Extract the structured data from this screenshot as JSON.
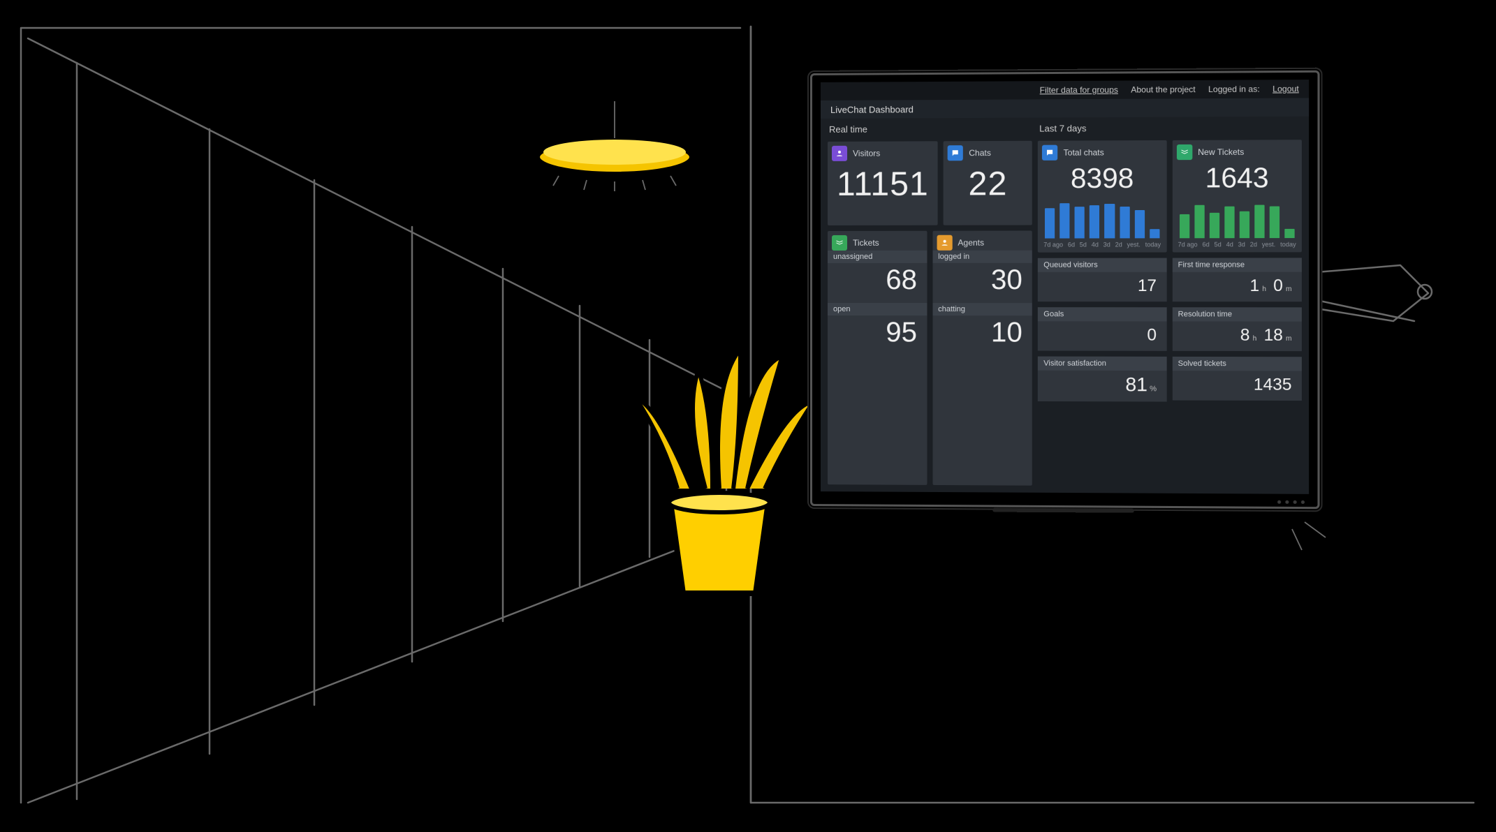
{
  "topbar": {
    "filter": "Filter data for groups",
    "about": "About the project",
    "logged_in_prefix": "Logged in as:",
    "logout": "Logout"
  },
  "title": "LiveChat Dashboard",
  "sections": {
    "realtime": "Real time",
    "last7": "Last 7 days"
  },
  "realtime": {
    "visitors": {
      "label": "Visitors",
      "value": "11151"
    },
    "chats": {
      "label": "Chats",
      "value": "22"
    },
    "tickets": {
      "label": "Tickets",
      "unassigned_label": "unassigned",
      "unassigned": "68",
      "open_label": "open",
      "open": "95"
    },
    "agents": {
      "label": "Agents",
      "logged_in_label": "logged in",
      "logged_in": "30",
      "chatting_label": "chatting",
      "chatting": "10"
    }
  },
  "last7": {
    "total_chats": {
      "label": "Total chats",
      "value": "8398"
    },
    "new_tickets": {
      "label": "New Tickets",
      "value": "1643"
    },
    "queued": {
      "label": "Queued visitors",
      "value": "17"
    },
    "goals": {
      "label": "Goals",
      "value": "0"
    },
    "satisfaction": {
      "label": "Visitor satisfaction",
      "value": "81",
      "unit": "%"
    },
    "first_resp": {
      "label": "First time response",
      "v1": "1",
      "u1": "h",
      "v2": "0",
      "u2": "m"
    },
    "resolution": {
      "label": "Resolution time",
      "v1": "8",
      "u1": "h",
      "v2": "18",
      "u2": "m"
    },
    "solved": {
      "label": "Solved tickets",
      "value": "1435"
    }
  },
  "chart_data": [
    {
      "type": "bar",
      "title": "Total chats",
      "categories": [
        "7d ago",
        "6d",
        "5d",
        "4d",
        "3d",
        "2d",
        "yest.",
        "today"
      ],
      "values": [
        1200,
        1400,
        1250,
        1300,
        1350,
        1250,
        1100,
        350
      ],
      "ylim": [
        0,
        1500
      ],
      "color": "#2f7bd6"
    },
    {
      "type": "bar",
      "title": "New Tickets",
      "categories": [
        "7d ago",
        "6d",
        "5d",
        "4d",
        "3d",
        "2d",
        "yest.",
        "today"
      ],
      "values": [
        190,
        260,
        200,
        250,
        210,
        260,
        250,
        70
      ],
      "ylim": [
        0,
        300
      ],
      "color": "#37a85a"
    }
  ]
}
